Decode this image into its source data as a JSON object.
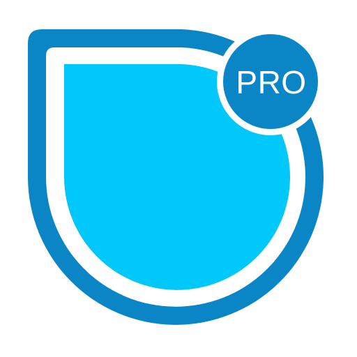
{
  "icon": {
    "name": "shield-droplet-app-icon",
    "badge_label": "PRO",
    "colors": {
      "outer_ring": "#0a86c6",
      "gap": "#ffffff",
      "inner_fill": "#00c8fa",
      "badge_fill": "#0a86c6",
      "badge_text": "#ffffff",
      "background": "#ffffff"
    }
  }
}
